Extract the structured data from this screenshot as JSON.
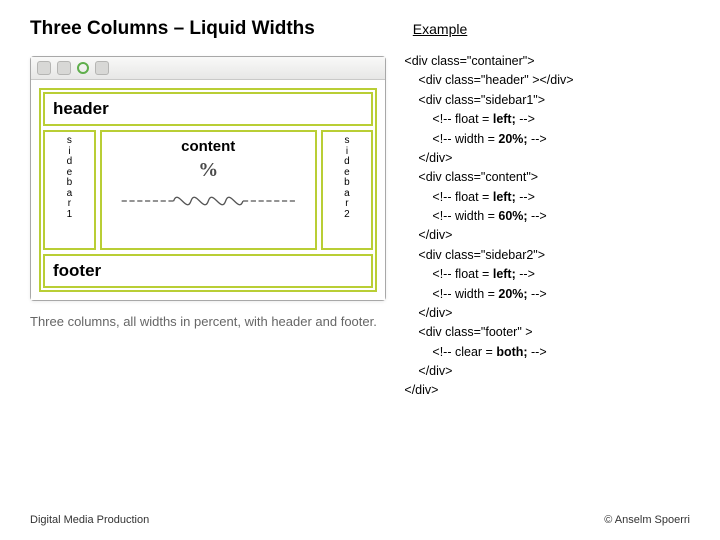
{
  "title": "Three Columns – Liquid Widths",
  "exampleLabel": "Example",
  "layout": {
    "header": "header",
    "sidebar1": [
      "s",
      "i",
      "d",
      "e",
      "b",
      "a",
      "r",
      "1"
    ],
    "content": "content",
    "percent": "%",
    "sidebar2": [
      "s",
      "i",
      "d",
      "e",
      "b",
      "a",
      "r",
      "2"
    ],
    "footer": "footer"
  },
  "caption": "Three columns, all widths in percent, with header and footer.",
  "code": {
    "l0": "<div class=\"container\">",
    "l1": "<div class=\"header\" ></div>",
    "l2": "<div class=\"sidebar1\">",
    "l3a": "<!-- float = ",
    "l3b": "left;",
    "l3c": " -->",
    "l4a": "<!-- width = ",
    "l4b": "20%;",
    "l4c": " -->",
    "l5": "</div>",
    "l6": "<div class=\"content\">",
    "l7a": "<!-- float = ",
    "l7b": "left;",
    "l7c": " -->",
    "l8a": "<!-- width = ",
    "l8b": "60%;",
    "l8c": " -->",
    "l9": "</div>",
    "l10": "<div class=\"sidebar2\">",
    "l11a": "<!-- float = ",
    "l11b": "left;",
    "l11c": " -->",
    "l12a": "<!-- width = ",
    "l12b": "20%;",
    "l12c": " -->",
    "l13": "</div>",
    "l14": "<div class=\"footer\" >",
    "l15a": "<!-- clear = ",
    "l15b": "both;",
    "l15c": " -->",
    "l16": "</div>",
    "l17": "</div>"
  },
  "footerLeft": "Digital Media Production",
  "footerRight": "© Anselm Spoerri"
}
